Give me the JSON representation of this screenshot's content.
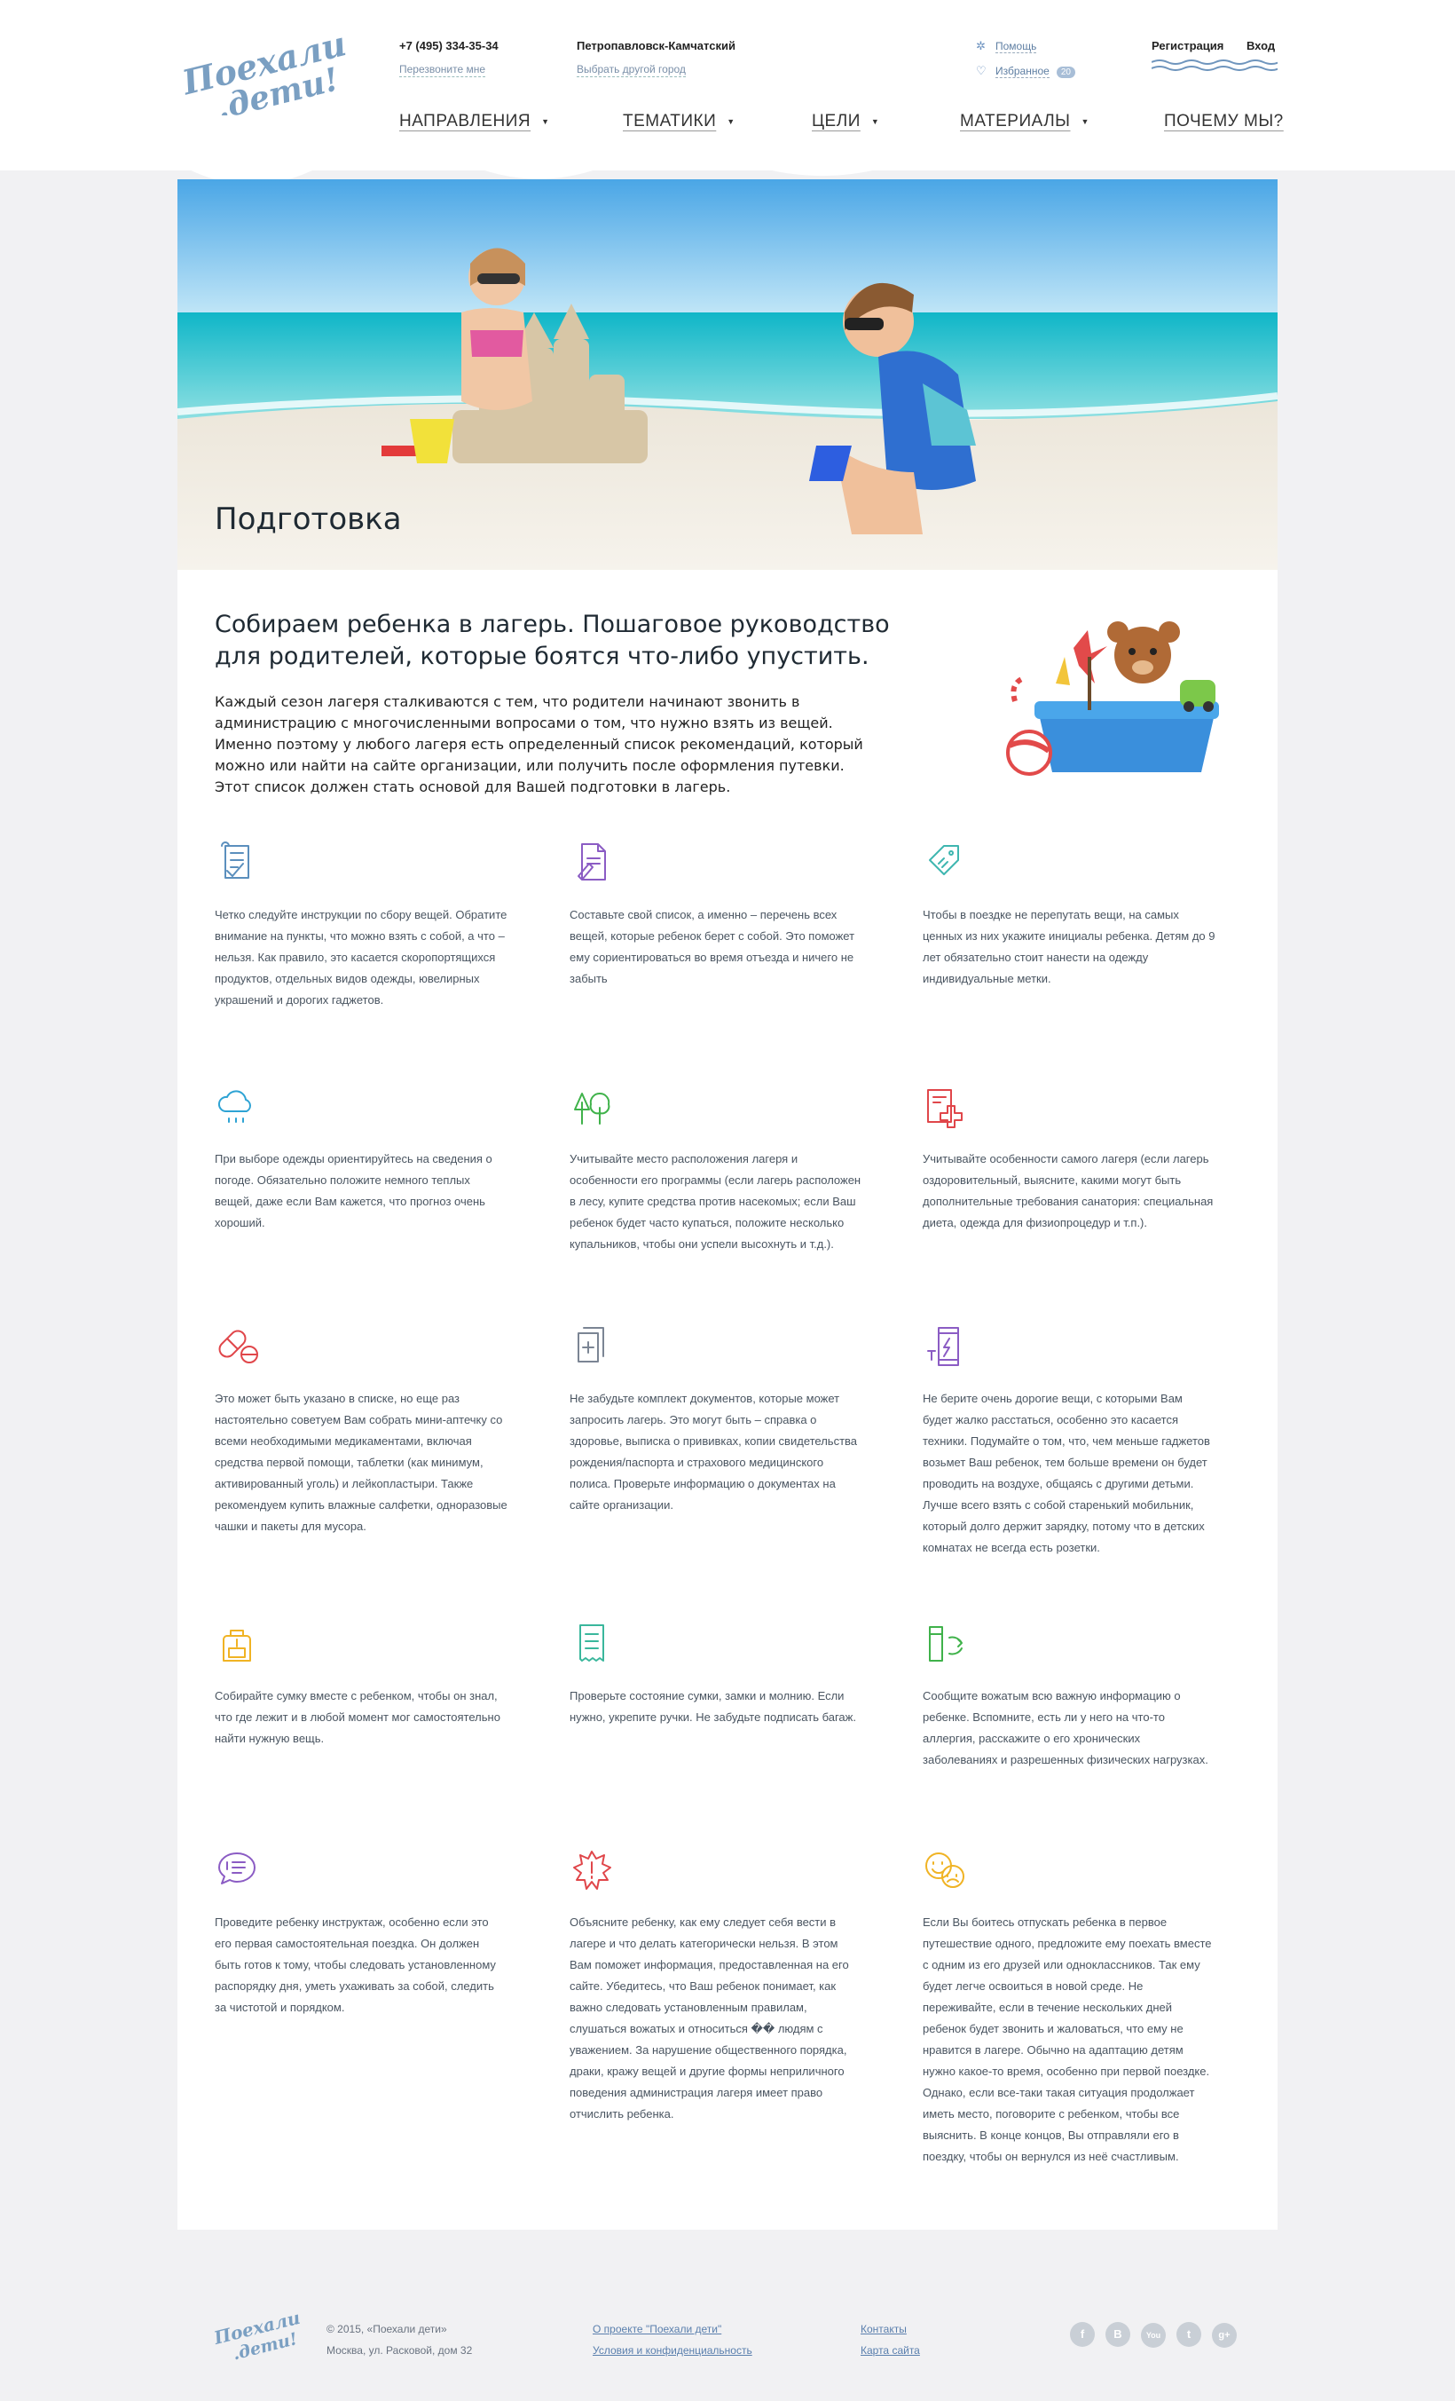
{
  "header": {
    "logo_line1": "Поехали",
    "logo_line2": ".дети!",
    "phone": "+7 (495) 334-35-34",
    "callback": "Перезвоните мне",
    "city": "Петропавловск-Камчатский",
    "choose_city": "Выбрать другой город",
    "help": "Помощь",
    "favorites": "Избранное",
    "favorites_count": "20",
    "register": "Регистрация",
    "login": "Вход"
  },
  "nav": {
    "items": [
      {
        "label": "НАПРАВЛЕНИЯ",
        "has_arrow": true
      },
      {
        "label": "ТЕМАТИКИ",
        "has_arrow": true
      },
      {
        "label": "ЦЕЛИ",
        "has_arrow": true
      },
      {
        "label": "МАТЕРИАЛЫ",
        "has_arrow": true
      },
      {
        "label": "ПОЧЕМУ МЫ?",
        "has_arrow": false
      }
    ],
    "arrow_glyph": "▼"
  },
  "hero": {
    "title": "Подготовка"
  },
  "intro": {
    "title": "Собираем ребенка в лагерь. Пошаговое руководство для родителей, которые боятся что-либо упустить.",
    "text": "Каждый сезон лагеря сталкиваются с тем, что родители начинают звонить в администрацию с многочисленными вопросами о том, что нужно взять из вещей. Именно поэтому у любого лагеря есть определенный список рекомендаций, который можно или найти на сайте организации, или получить после оформления путевки. Этот список должен стать основой для Вашей подготовки в лагерь."
  },
  "tips": [
    {
      "icon": "checklist-scroll-icon",
      "color": "#5b8fbd",
      "text": "Четко следуйте инструкции по сбору вещей. Обратите внимание на пункты, что можно взять с собой, а что – нельзя. Как правило, это касается скоропортящихся продуктов, отдельных видов одежды, ювелирных украшений и дорогих гаджетов."
    },
    {
      "icon": "write-list-icon",
      "color": "#8b5cc4",
      "text": "Составьте свой список, а именно – перечень всех вещей, которые ребенок берет с собой. Это поможет ему сориентироваться во время отъезда и ничего не забыть"
    },
    {
      "icon": "name-tag-icon",
      "color": "#3fb6b0",
      "text": "Чтобы в поездке не перепутать вещи, на самых ценных из них укажите инициалы ребенка. Детям до 9 лет обязательно стоит нанести на одежду индивидуальные метки."
    },
    {
      "icon": "rain-cloud-icon",
      "color": "#2ea3d4",
      "text": "При выборе одежды ориентируйтесь на сведения о погоде. Обязательно положите немного теплых вещей, даже если Вам кажется, что прогноз очень хороший."
    },
    {
      "icon": "trees-icon",
      "color": "#3fb24a",
      "text": "Учитывайте место расположения лагеря и особенности его программы (если лагерь расположен в лесу, купите средства против насекомых; если Ваш ребенок будет часто купаться, положите несколько купальников, чтобы они успели высохнуть и т.д.)."
    },
    {
      "icon": "medical-form-icon",
      "color": "#e0464a",
      "text": "Учитывайте особенности самого лагеря (если лагерь оздоровительный, выясните, какими могут быть дополнительные требования санатория: специальная диета, одежда для физиопроцедур и т.п.)."
    },
    {
      "icon": "pills-icon",
      "color": "#e0464a",
      "text": "Это может быть указано в списке, но еще раз настоятельно советуем Вам собрать мини-аптечку со всеми необходимыми медикаментами, включая средства первой помощи, таблетки (как минимум, активированный уголь) и лейкопластыри. Также рекомендуем купить влажные салфетки, одноразовые чашки и пакеты для мусора."
    },
    {
      "icon": "documents-icon",
      "color": "#7b8594",
      "text": "Не забудьте комплект документов, которые может запросить лагерь. Это могут быть – справка о здоровье, выписка о прививках, копии свидетельства рождения/паспорта и страхового медицинского полиса. Проверьте информацию о документах на сайте организации."
    },
    {
      "icon": "phone-charging-icon",
      "color": "#8b5cc4",
      "text": "Не берите очень дорогие вещи, с которыми Вам будет жалко расстаться, особенно это касается техники. Подумайте о том, что, чем меньше гаджетов возьмет Ваш ребенок, тем больше времени он будет проводить на воздухе, общаясь с другими детьми. Лучше всего взять с собой старенький мобильник, который долго держит зарядку, потому что в детских комнатах не всегда есть розетки."
    },
    {
      "icon": "backpack-icon",
      "color": "#f0b324",
      "text": "Собирайте сумку вместе с ребенком, чтобы он знал, что где лежит и в любой момент мог самостоятельно найти нужную вещь."
    },
    {
      "icon": "receipt-icon",
      "color": "#3ab79c",
      "text": "Проверьте состояние сумки, замки и молнию. Если нужно, укрепите ручки. Не забудьте подписать багаж."
    },
    {
      "icon": "info-exchange-icon",
      "color": "#3fb24a",
      "text": "Сообщите вожатым всю важную информацию о ребенке. Вспомните, есть ли у него на что-то аллергия, расскажите о его хронических заболеваниях и разрешенных физических нагрузках."
    },
    {
      "icon": "speech-bubble-icon",
      "color": "#8b5cc4",
      "text": "Проведите ребенку инструктаж, особенно если это его первая самостоятельная поездка. Он должен быть готов к тому, чтобы следовать установленному распорядку дня, уметь ухаживать за собой, следить за чистотой и порядком."
    },
    {
      "icon": "warning-burst-icon",
      "color": "#e0464a",
      "text": "Объясните ребенку, как ему следует себя вести в лагере и что делать категорически нельзя. В этом Вам поможет информация, предоставленная на его сайте. Убедитесь, что Ваш ребенок понимает, как важно следовать установленным правилам, слушаться вожатых и относиться �� людям с уважением. За нарушение общественного порядка, драки, кражу вещей и другие формы неприличного поведения администрация лагеря имеет право отчислить ребенка."
    },
    {
      "icon": "happy-sad-faces-icon",
      "color": "#f0b324",
      "text": "Если Вы боитесь отпускать ребенка в первое путешествие одного, предложите ему поехать вместе с одним из его друзей или одноклассников. Так ему будет легче освоиться в новой среде. Не переживайте, если в течение нескольких дней ребенок будет звонить и жаловаться, что ему не нравится в лагере. Обычно на адаптацию детям нужно какое-то время, особенно при первой поездке. Однако, если все-таки такая ситуация продолжает иметь место, поговорите с ребенком, чтобы все выяснить. В конце концов, Вы отправляли его в поездку, чтобы он вернулся из неё счастливым."
    }
  ],
  "footer": {
    "logo_line1": "Поехали",
    "logo_line2": ".дети!",
    "copyright": "© 2015, «Поехали дети»",
    "address": "Москва, ул. Расковой, дом 32",
    "links_col1": [
      "О проекте \"Поехали дети\"",
      "Условия и конфиденциальность"
    ],
    "links_col2": [
      "Контакты",
      "Карта сайта"
    ],
    "social": [
      "f",
      "В",
      "You",
      "t",
      "g+"
    ]
  }
}
